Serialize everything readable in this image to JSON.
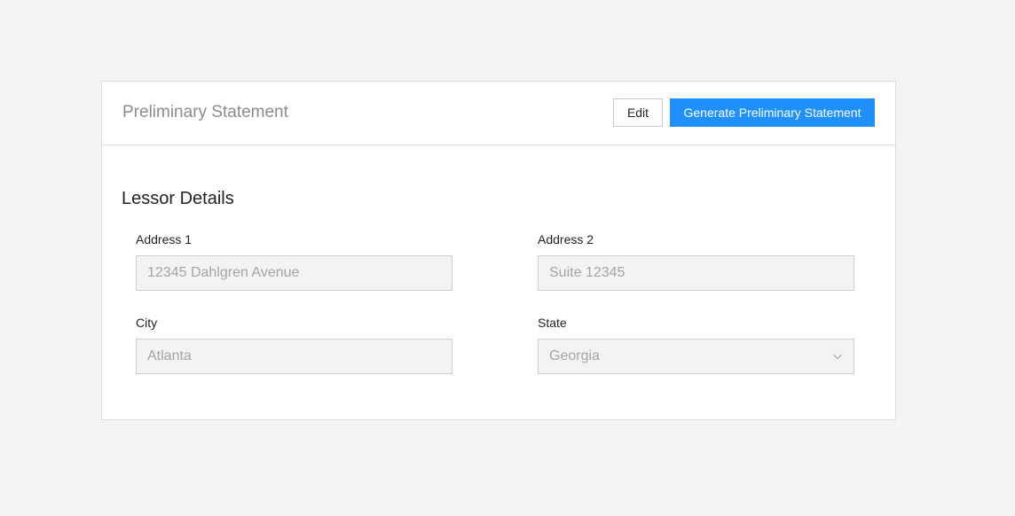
{
  "header": {
    "title": "Preliminary Statement",
    "edit_label": "Edit",
    "generate_label": "Generate Preliminary Statement"
  },
  "lessor": {
    "section_title": "Lessor Details",
    "address1": {
      "label": "Address 1",
      "value": "12345 Dahlgren Avenue"
    },
    "address2": {
      "label": "Address 2",
      "value": "Suite 12345"
    },
    "city": {
      "label": "City",
      "value": "Atlanta"
    },
    "state": {
      "label": "State",
      "value": "Georgia"
    }
  },
  "colors": {
    "background": "#f4f4f4",
    "primary": "#1e90ff",
    "input_bg": "#f3f3f3",
    "disabled_text": "#a5a5a5"
  },
  "icons": {
    "state_dropdown": "chevron-down-icon"
  }
}
